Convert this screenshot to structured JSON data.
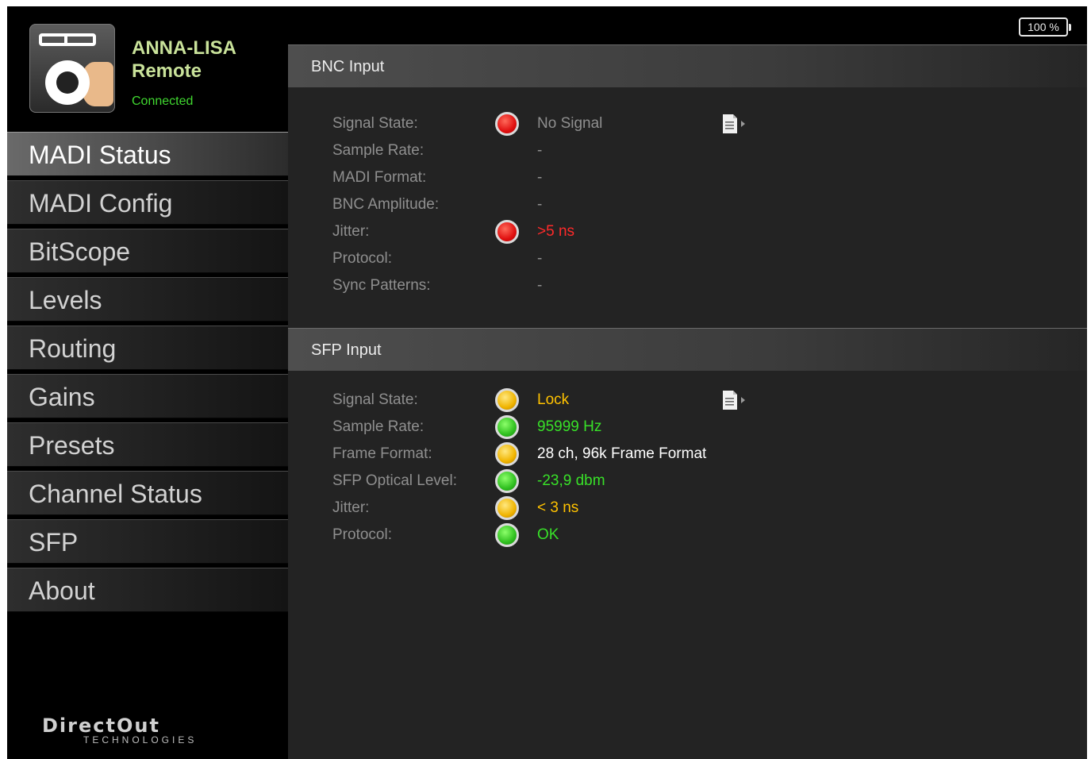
{
  "battery": "100 %",
  "app": {
    "name_line1": "ANNA-LISA",
    "name_line2": "Remote",
    "connection_status": "Connected"
  },
  "nav": [
    {
      "label": "MADI Status",
      "active": true
    },
    {
      "label": "MADI Config"
    },
    {
      "label": "BitScope"
    },
    {
      "label": "Levels"
    },
    {
      "label": "Routing"
    },
    {
      "label": "Gains"
    },
    {
      "label": "Presets"
    },
    {
      "label": "Channel Status"
    },
    {
      "label": "SFP"
    },
    {
      "label": "About"
    }
  ],
  "brand": {
    "wordmark": "DirectOut",
    "tagline": "TECHNOLOGIES"
  },
  "bnc": {
    "title": "BNC Input",
    "rows": [
      {
        "label": "Signal State:",
        "led": "red",
        "value": "No Signal"
      },
      {
        "label": "Sample Rate:",
        "value": "-"
      },
      {
        "label": "MADI Format:",
        "value": "-"
      },
      {
        "label": "BNC Amplitude:",
        "value": "-"
      },
      {
        "label": "Jitter:",
        "led": "red",
        "value": ">5 ns"
      },
      {
        "label": "Protocol:",
        "value": "-"
      },
      {
        "label": "Sync Patterns:",
        "value": "-"
      }
    ]
  },
  "sfp": {
    "title": "SFP Input",
    "rows": [
      {
        "label": "Signal State:",
        "led": "yellow",
        "value": "Lock"
      },
      {
        "label": "Sample Rate:",
        "led": "green",
        "value": "95999 Hz"
      },
      {
        "label": "Frame Format:",
        "led": "yellow",
        "value": "28 ch, 96k Frame Format"
      },
      {
        "label": "SFP Optical Level:",
        "led": "green",
        "value": "-23,9 dbm"
      },
      {
        "label": "Jitter:",
        "led": "yellow",
        "value": "< 3 ns"
      },
      {
        "label": "Protocol:",
        "led": "green",
        "value": "OK"
      }
    ]
  },
  "colors": {
    "connected": "#40d830",
    "led_red": "#e01010",
    "led_green": "#30c020",
    "led_yellow": "#f0b400"
  },
  "icons": {
    "report": "document-arrow-icon",
    "battery": "battery-icon",
    "logo": "app-logo-icon"
  }
}
